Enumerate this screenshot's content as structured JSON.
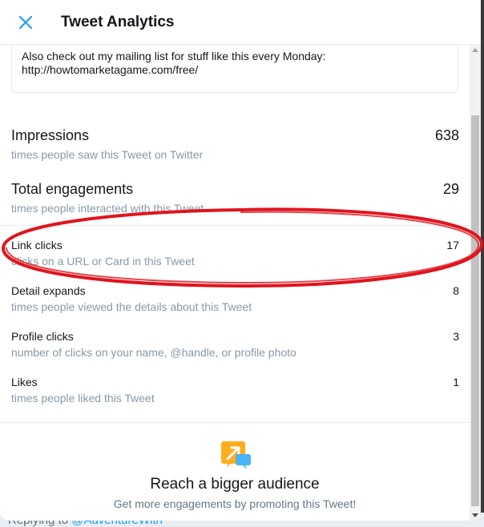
{
  "header": {
    "title": "Tweet Analytics",
    "close_icon": "close-icon"
  },
  "tweet": {
    "text_line1": "Also check out my mailing list for stuff like this every Monday:",
    "text_line2": "http://howtomarketagame.com/free/"
  },
  "stats": [
    {
      "label": "Impressions",
      "description": "times people saw this Tweet on Twitter",
      "value": "638"
    },
    {
      "label": "Total engagements",
      "description": "times people interacted with this Tweet",
      "value": "29"
    },
    {
      "label": "Link clicks",
      "description": "clicks on a URL or Card in this Tweet",
      "value": "17"
    },
    {
      "label": "Detail expands",
      "description": "times people viewed the details about this Tweet",
      "value": "8"
    },
    {
      "label": "Profile clicks",
      "description": "number of clicks on your name, @handle, or profile photo",
      "value": "3"
    },
    {
      "label": "Likes",
      "description": "times people liked this Tweet",
      "value": "1"
    }
  ],
  "promo": {
    "icon": "promote-icon",
    "title": "Reach a bigger audience",
    "subtitle": "Get more engagements by promoting this Tweet!"
  },
  "background": {
    "reply_prefix": "Replying to",
    "reply_handle": "@AdventureWith"
  },
  "colors": {
    "accent": "#1da1f2",
    "annotation": "#e0141e",
    "promo_orange": "#ffad1f"
  }
}
